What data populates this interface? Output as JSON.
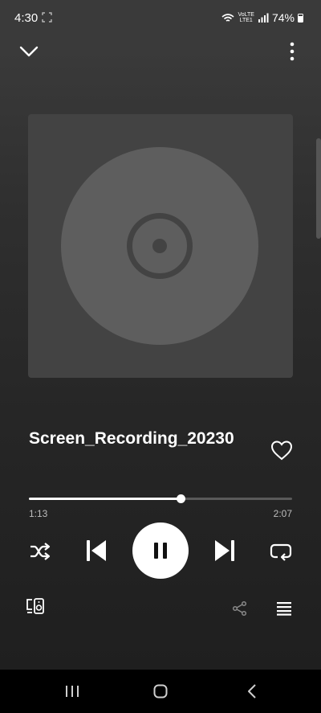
{
  "status_bar": {
    "time": "4:30",
    "volte": "VoLTE",
    "network": "LTE1",
    "battery": "74%"
  },
  "player": {
    "title": "Screen_Recording_20230",
    "elapsed": "1:13",
    "duration": "2:07",
    "progress": 0.575,
    "state": "playing",
    "liked": false
  },
  "icons": {
    "collapse": "chevron-down-icon",
    "more": "more-vertical-icon",
    "like": "heart-icon",
    "shuffle": "shuffle-icon",
    "previous": "skip-previous-icon",
    "pause": "pause-icon",
    "next": "skip-next-icon",
    "repeat": "repeat-icon",
    "devices": "connect-device-icon",
    "share": "share-icon",
    "queue": "queue-icon"
  },
  "colors": {
    "background": "#2f2f2f",
    "artwork": "#434343",
    "disc": "#5e5e5e",
    "accent": "#ffffff",
    "muted": "#bdbdbd",
    "nav": "#000000"
  }
}
